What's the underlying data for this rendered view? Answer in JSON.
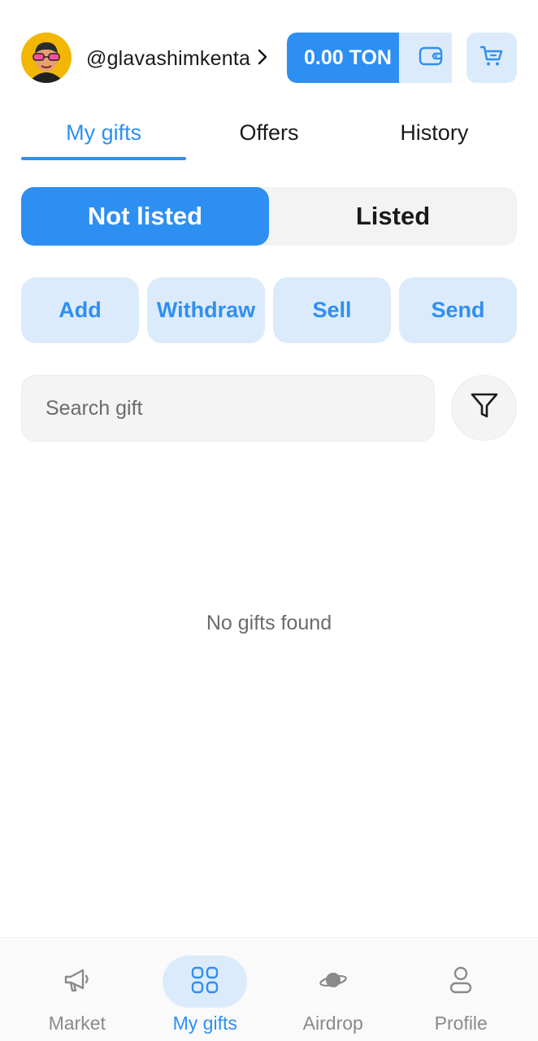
{
  "header": {
    "username": "@glavashimkenta",
    "balance": "0.00 TON"
  },
  "tabs": [
    {
      "label": "My gifts",
      "active": true
    },
    {
      "label": "Offers",
      "active": false
    },
    {
      "label": "History",
      "active": false
    }
  ],
  "segment": [
    {
      "label": "Not listed",
      "active": true
    },
    {
      "label": "Listed",
      "active": false
    }
  ],
  "actions": [
    "Add",
    "Withdraw",
    "Sell",
    "Send"
  ],
  "search": {
    "placeholder": "Search gift",
    "value": ""
  },
  "empty_text": "No gifts found",
  "bottom_nav": [
    {
      "label": "Market",
      "icon": "megaphone-icon",
      "active": false
    },
    {
      "label": "My gifts",
      "icon": "grid-icon",
      "active": true
    },
    {
      "label": "Airdrop",
      "icon": "planet-icon",
      "active": false
    },
    {
      "label": "Profile",
      "icon": "person-icon",
      "active": false
    }
  ],
  "colors": {
    "accent": "#2e8ff3",
    "accent_light": "#dcebfb",
    "avatar_bg": "#f2b705"
  }
}
